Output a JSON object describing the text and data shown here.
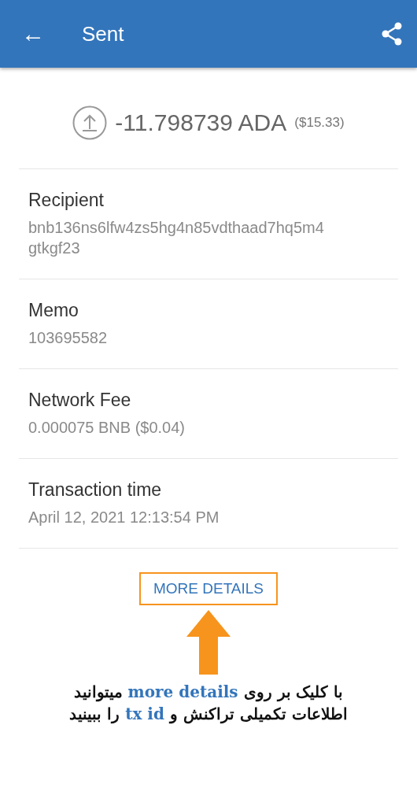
{
  "app_bar": {
    "back": "←",
    "title": "Sent"
  },
  "amount": {
    "value": "-11.798739 ADA",
    "fiat": "($15.33)"
  },
  "details": [
    {
      "label": "Recipient",
      "value": "bnb136ns6lfw4zs5hg4n85vdthaad7hq5m4gtkgf23"
    },
    {
      "label": "Memo",
      "value": "103695582"
    },
    {
      "label": "Network Fee",
      "value": "0.000075 BNB ($0.04)"
    },
    {
      "label": "Transaction time",
      "value": "April 12, 2021 12:13:54 PM"
    }
  ],
  "more_details": {
    "label": "MORE DETAILS",
    "highlighted": true
  },
  "annotation": [
    [
      {
        "text": "با کلیک بر روی ",
        "highlight": false
      },
      {
        "text": "more details",
        "highlight": true
      },
      {
        "text": " میتوانید",
        "highlight": false
      }
    ],
    [
      {
        "text": "اطلاعات تکمیلی تراکنش و ",
        "highlight": false
      },
      {
        "text": "tx id",
        "highlight": true
      },
      {
        "text": " را ببینید",
        "highlight": false
      }
    ]
  ]
}
